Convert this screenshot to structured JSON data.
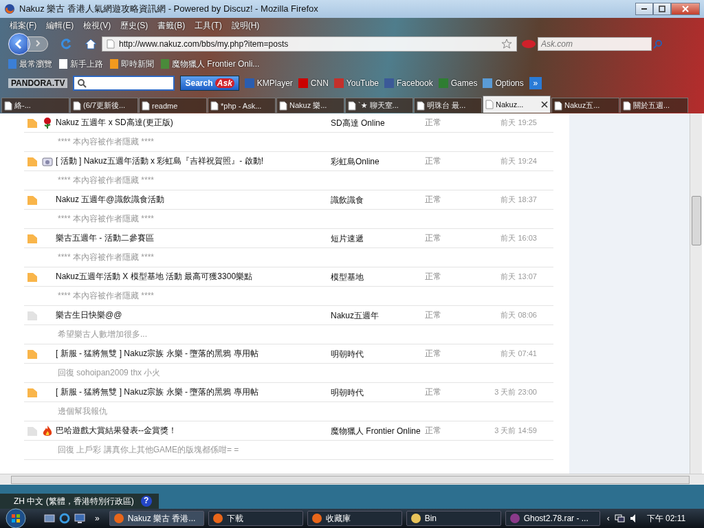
{
  "window": {
    "title": "Nakuz 樂古 香港人氣網遊攻略資訊網 - Powered by Discuz! - Mozilla Firefox"
  },
  "menu": [
    "檔案(F)",
    "編輯(E)",
    "檢視(V)",
    "歷史(S)",
    "書籤(B)",
    "工具(T)",
    "說明(H)"
  ],
  "nav": {
    "url": "http://www.nakuz.com/bbs/my.php?item=posts",
    "search_placeholder": "Ask.com"
  },
  "bookmarks": [
    {
      "label": "最常瀏覽",
      "kind": "search"
    },
    {
      "label": "新手上路",
      "kind": "page"
    },
    {
      "label": "即時新聞",
      "kind": "feed"
    },
    {
      "label": "魔物獵人 Frontier Onli...",
      "kind": "game"
    }
  ],
  "toolbar": {
    "brand": "PANDORA.TV",
    "search_button": "Search",
    "ask": "Ask",
    "items": [
      {
        "label": "KMPlayer",
        "kind": "km"
      },
      {
        "label": "CNN",
        "kind": "cnn"
      },
      {
        "label": "YouTube",
        "kind": "yt"
      },
      {
        "label": "Facebook",
        "kind": "fb"
      },
      {
        "label": "Games",
        "kind": "games"
      },
      {
        "label": "Options",
        "kind": "options"
      }
    ],
    "more": "»"
  },
  "tabs": [
    {
      "label": "絡-...",
      "selected": false
    },
    {
      "label": "(6/7更新後...",
      "selected": false
    },
    {
      "label": "readme",
      "selected": false
    },
    {
      "label": "*php - Ask...",
      "selected": false
    },
    {
      "label": "Nakuz 樂...",
      "selected": false
    },
    {
      "label": "`★ 聊天室...",
      "selected": false
    },
    {
      "label": "明珠台 最...",
      "selected": false
    },
    {
      "label": "Nakuz...",
      "selected": true
    },
    {
      "label": "Nakuz五...",
      "selected": false
    },
    {
      "label": "關於五週...",
      "selected": false
    }
  ],
  "posts": [
    {
      "title": "Nakuz 五週年 x SD高達(更正版)",
      "forum": "SD高達 Online",
      "status": "正常",
      "time": "前天 19:25",
      "excerpt": "**** 本內容被作者隱藏 ****",
      "unread": true,
      "kind": "flower"
    },
    {
      "title": "[ 活動 ] Nakuz五週年活動 x 彩虹島『吉祥祝賀照』- 啟動!",
      "forum": "彩虹島Online",
      "status": "正常",
      "time": "前天 19:24",
      "excerpt": "**** 本內容被作者隱藏 ****",
      "unread": true,
      "kind": "camera"
    },
    {
      "title": "Nakuz 五週年@識飲識食活動",
      "forum": "識飲識食",
      "status": "正常",
      "time": "前天 18:37",
      "excerpt": "**** 本內容被作者隱藏 ****",
      "unread": true,
      "kind": "plain"
    },
    {
      "title": "樂古五週年 - 活動二參賽區",
      "forum": "短片速遞",
      "status": "正常",
      "time": "前天 16:03",
      "excerpt": "**** 本內容被作者隱藏 ****",
      "unread": true,
      "kind": "plain"
    },
    {
      "title": "Nakuz五週年活動 X 模型基地 活動 最高可獲3300樂點",
      "forum": "模型基地",
      "status": "正常",
      "time": "前天 13:07",
      "excerpt": "**** 本內容被作者隱藏 ****",
      "unread": true,
      "kind": "plain"
    },
    {
      "title": "樂古生日快樂@@",
      "forum": "Nakuz五週年",
      "status": "正常",
      "time": "前天 08:06",
      "excerpt": "希望樂古人數增加很多...",
      "unread": false,
      "kind": "plain"
    },
    {
      "title": "[ 新服 - 猛將無雙 ] Nakuz宗族 永樂 - 墮落的黑鴉 專用帖",
      "forum": "明朝時代",
      "status": "正常",
      "time": "前天 07:41",
      "excerpt": "回復 sohoipan2009 thx 小火",
      "unread": true,
      "kind": "plain"
    },
    {
      "title": "[ 新服 - 猛將無雙 ] Nakuz宗族 永樂 - 墮落的黑鴉 專用帖",
      "forum": "明朝時代",
      "status": "正常",
      "time": "3 天前 23:00",
      "excerpt": "邊個幫我報仇",
      "unread": true,
      "kind": "plain"
    },
    {
      "title": "巴哈遊戲大賞結果發表--金賞獎！",
      "forum": "魔物獵人 Frontier Online",
      "status": "正常",
      "time": "3 天前 14:59",
      "excerpt": "回復 上戶彩 講真你上其他GAME的版塊都係咁= =",
      "unread": false,
      "kind": "fire"
    }
  ],
  "language_bar": {
    "label": "ZH 中文 (繁體，香港特別行政區)",
    "help": "?"
  },
  "taskbar": {
    "more": "»",
    "items": [
      {
        "label": "Nakuz 樂古 香港...",
        "kind": "firefox",
        "selected": true
      },
      {
        "label": "下載",
        "kind": "firefox",
        "selected": false
      },
      {
        "label": "收藏庫",
        "kind": "firefox",
        "selected": false
      },
      {
        "label": "Bin",
        "kind": "folder",
        "selected": false
      },
      {
        "label": "Ghost2.78.rar - ...",
        "kind": "archive",
        "selected": false
      }
    ],
    "tray_arrow": "‹",
    "clock": "下午 02:11"
  }
}
